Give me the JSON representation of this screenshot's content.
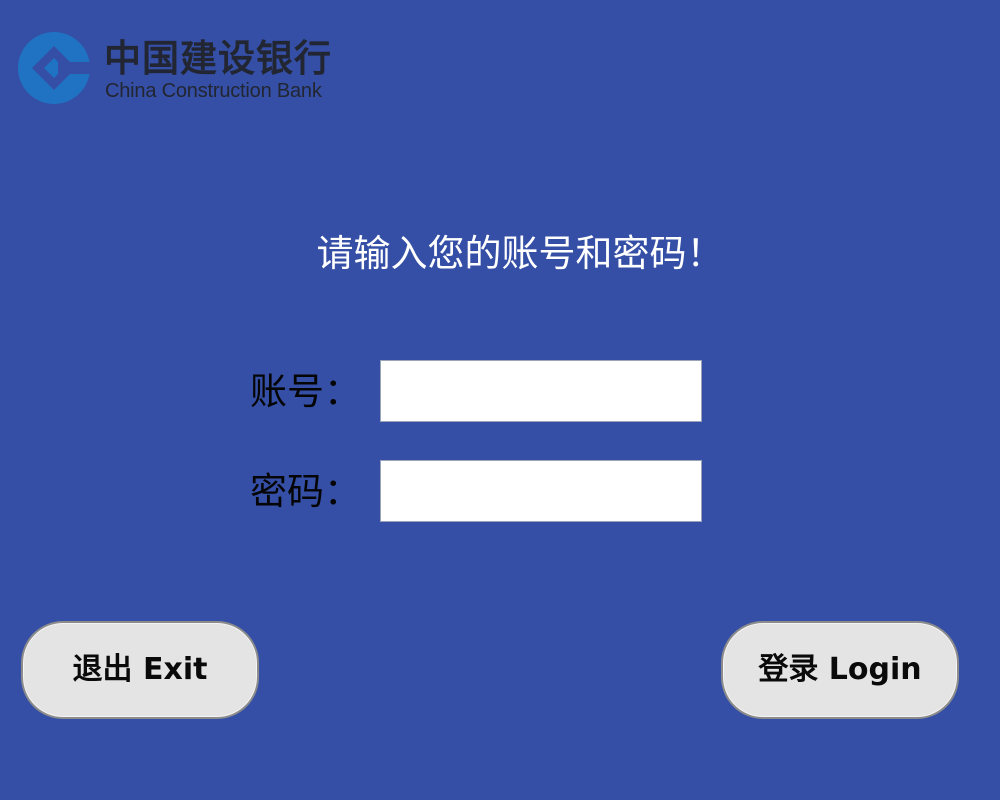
{
  "logo": {
    "name_cn": "中国建设银行",
    "name_en": "China Construction Bank",
    "icon": "ccb-logo-icon",
    "brand_color": "#1f73c2"
  },
  "prompt": {
    "text": "请输入您的账号和密码！"
  },
  "form": {
    "account_label": "账号：",
    "account_value": "",
    "password_label": "密码：",
    "password_value": ""
  },
  "buttons": {
    "exit_label": "退出 Exit",
    "login_label": "登录 Login"
  },
  "colors": {
    "background": "#344fa5",
    "prompt_text": "#ffffff",
    "label_text": "#050505",
    "input_background": "#ffffff",
    "button_background": "#e4e4e4",
    "button_border": "#8c8c8c"
  }
}
